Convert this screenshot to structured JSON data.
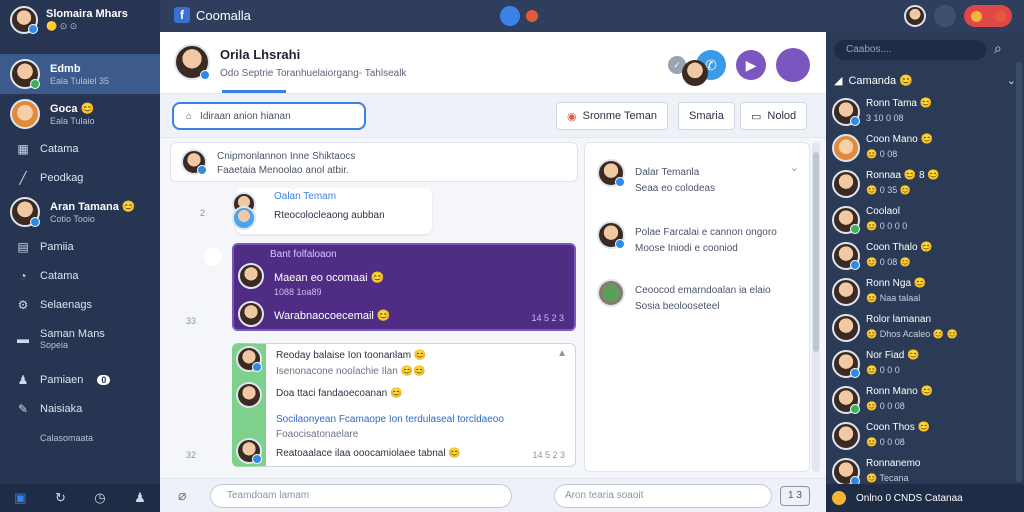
{
  "topbar": {
    "app_name": "Coomalla",
    "colors": {
      "accent": "#3b82e6",
      "purple": "#4f2d85",
      "sidebar_bg": "#273552"
    }
  },
  "sidebar": {
    "profile_name": "Slomaira Mhars",
    "profile_status": "🟡 ⊙ ⊙",
    "items": [
      {
        "label": "Edmb",
        "sub": "Eala Tulaiel 35",
        "icon": "avatar",
        "active": true
      },
      {
        "label": "Goca 😊",
        "sub": "Eala Tulaio",
        "icon": "avatar"
      },
      {
        "label": "Catama",
        "icon": "calendar-icon"
      },
      {
        "label": "Peodkag",
        "icon": "wrench-icon"
      },
      {
        "label": "Aran Tamana 😊",
        "sub": "Cotio Tooio",
        "icon": "avatar"
      },
      {
        "label": "Pamiia",
        "icon": "grid-icon"
      },
      {
        "label": "Catama",
        "icon": "clock-icon"
      },
      {
        "label": "Selaenags",
        "icon": "settings-icon"
      },
      {
        "label": "Saman Mans",
        "sub": "Sopeia",
        "icon": "folder-icon"
      },
      {
        "label": "Pamiaen",
        "icon": "people-icon",
        "badge": "0"
      },
      {
        "label": "Naisiaka",
        "icon": "pin-icon"
      },
      {
        "label": "Calasomaata",
        "icon": "none"
      }
    ]
  },
  "main": {
    "title": "Orila Lhsrahi",
    "subtitle": "Odo Septrie Toranhuelaiorgang- Tahlsealk",
    "search_placeholder": "Idiraan anion hianan",
    "toolbar_btn1": "Sronme Teman",
    "toolbar_btn2": "Smaria",
    "toolbar_btn3": "Nolod"
  },
  "chat": {
    "head_line1": "Cnipmonlannon Inne Shiktaocs",
    "head_line2": "Faaetaia Menoolao anol atbir.",
    "msg1_name": "Oalan Temam",
    "msg1_body": "Rteocolocleaong aubban",
    "purple_header": "Bant folfaloaon",
    "purple_line1": "Maean eo ocomaai 😊",
    "purple_line1_sub": "1088 1oa89",
    "purple_line2": "Warabnaocoecemail 😊",
    "purple_ts": "14 5 2 3",
    "left_meta1": "2",
    "left_meta2": "33",
    "left_meta3": "32",
    "green_line1": "Reoday balaise Ion toonanlam 😊",
    "green_line2": "Isenonacone noolachie Ilan 😊😊",
    "green_line3": "Doa ttaci fandaoecoanan 😊",
    "green_line4": "Socilaonyean Fcamaope Ion terdulaseal torcldaeoo",
    "green_line5": "Foaocisatonaelare",
    "green_line6": "Reatoaalace ilaa ooocamiolaee tabnal 😊",
    "green_ts": "14 5 2 3"
  },
  "inner_right": {
    "item1_name": "Dalar Temanla",
    "item1_sub": "Seaa eo colodeas",
    "item2_line1": "Polae Farcalai e cannon ongoro",
    "item2_line2": "Moose Iniodi e cooniod",
    "item3_line1": "Ceoocod emarndoalan ia elaio",
    "item3_line2": "Sosia beolooseteel"
  },
  "compose": {
    "input1_placeholder": "Teamdoam lamam",
    "input2_placeholder": "Aron tearia soaoit",
    "send_label": "1 3"
  },
  "contacts": {
    "search_placeholder": "Caabos....",
    "header": "Camanda 😊",
    "items": [
      {
        "name": "Ronn Tama 😊",
        "status": "3 10 0 08"
      },
      {
        "name": "Coon Mano 😊",
        "status": "😊 0 08"
      },
      {
        "name": "Ronnaa 😊 8 😊",
        "status": "😊 0 35 😊"
      },
      {
        "name": "Coolaol",
        "status": "😊 0 0 0 0"
      },
      {
        "name": "Coon Thalo 😊",
        "status": "😊 0 08 😊"
      },
      {
        "name": "Ronn Nga 😊",
        "status": "😊 Naa talaal"
      },
      {
        "name": "Rolor lamanan",
        "status": "😊 Dhos Acaleo 😊 😊"
      },
      {
        "name": "Nor Fiad 😊",
        "status": "😊 0 0 0"
      },
      {
        "name": "Ronn Mano 😊",
        "status": "😊 0 0 08"
      },
      {
        "name": "Coon Thos 😊",
        "status": "😊 0 0 08"
      },
      {
        "name": "Ronnanemo",
        "status": "😊 Tecana"
      }
    ],
    "bottom_text": "Onlno 0 CNDS Catanaa"
  }
}
